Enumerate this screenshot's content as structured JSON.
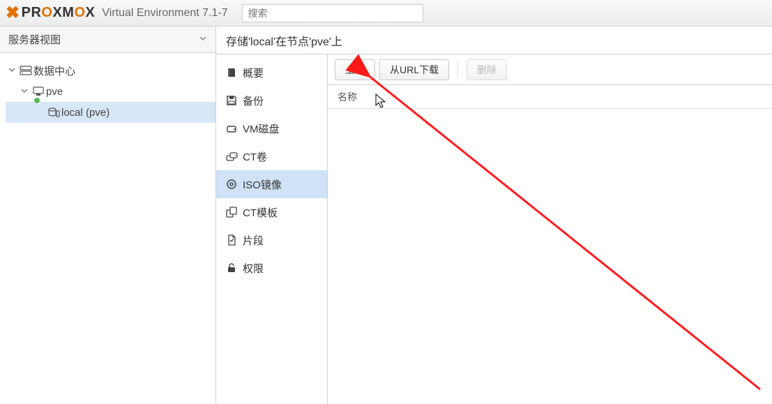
{
  "header": {
    "logo_text_pre": "PR",
    "logo_text_o": "O",
    "logo_text_mid": "XM",
    "logo_text_o2": "O",
    "logo_text_post": "X",
    "version": "Virtual Environment 7.1-7",
    "search_placeholder": "搜索"
  },
  "left": {
    "view_label": "服务器视图",
    "tree": {
      "root": "数据中心",
      "node": "pve",
      "storage": "local (pve)"
    }
  },
  "content": {
    "title": "存储'local'在节点'pve'上"
  },
  "subnav": {
    "summary": "概要",
    "backup": "备份",
    "vmdisk": "VM磁盘",
    "ctvol": "CT卷",
    "iso": "ISO镜像",
    "cttpl": "CT模板",
    "snippet": "片段",
    "perm": "权限"
  },
  "toolbar": {
    "upload": "上传",
    "download_url": "从URL下载",
    "delete": "删除"
  },
  "columns": {
    "name": "名称"
  }
}
